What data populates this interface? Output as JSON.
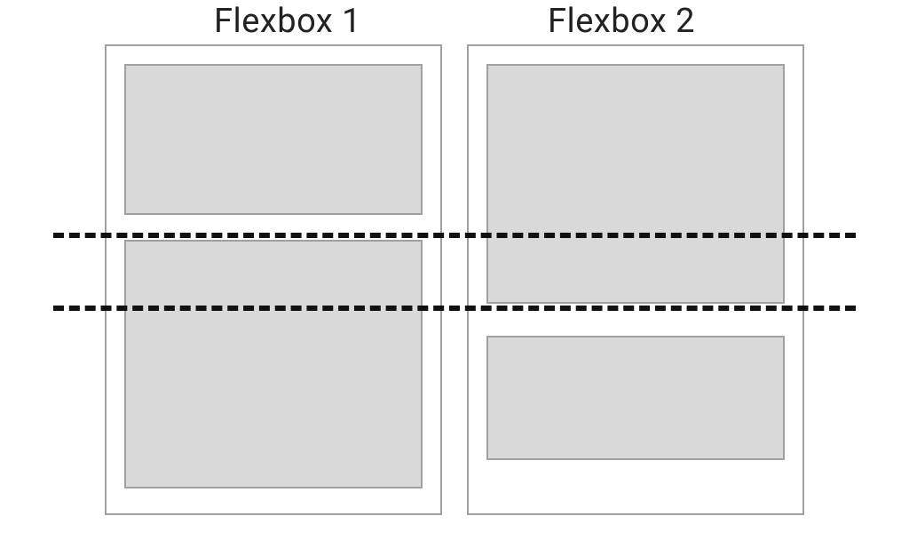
{
  "diagram": {
    "title_a": "Flexbox 1",
    "title_b": "Flexbox 2"
  }
}
